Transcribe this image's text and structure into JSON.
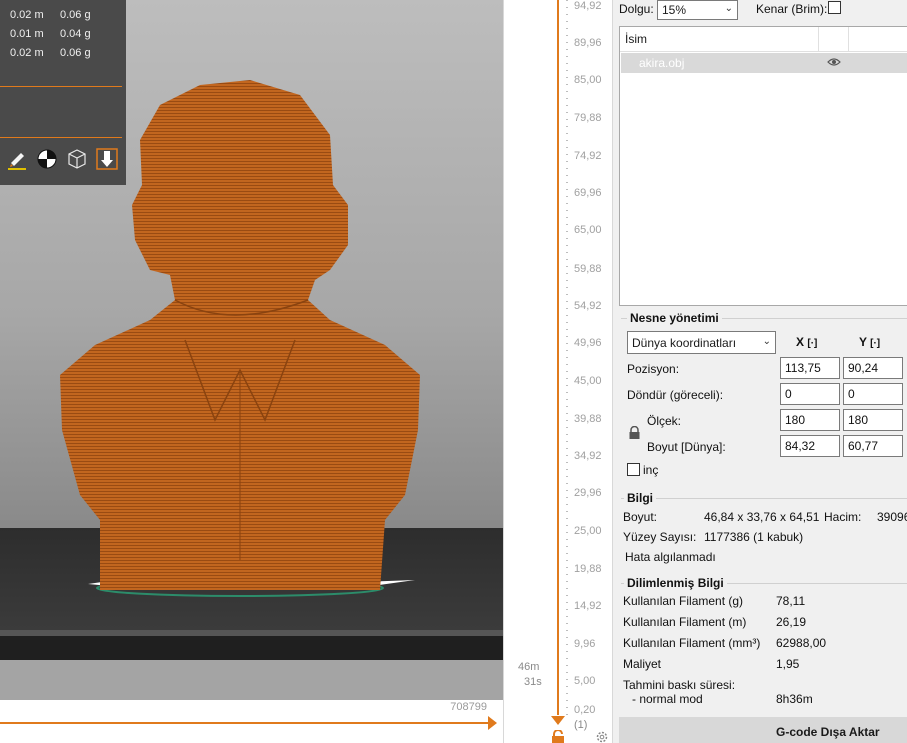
{
  "viewport": {
    "stats": [
      {
        "length": "0.02 m",
        "weight": "0.06 g"
      },
      {
        "length": "0.01 m",
        "weight": "0.04 g"
      },
      {
        "length": "0.02 m",
        "weight": "0.06 g"
      }
    ],
    "layer_count": "708799",
    "tools": [
      "paint-icon",
      "color-wheel-icon",
      "cube-icon",
      "download-arrow-icon"
    ]
  },
  "layer_slider": {
    "ticks": [
      "94,92",
      "89,96",
      "85,00",
      "79,88",
      "74,92",
      "69,96",
      "65,00",
      "59,88",
      "54,92",
      "49,96",
      "45,00",
      "39,88",
      "34,92",
      "29,96",
      "25,00",
      "19,88",
      "14,92",
      "9,96",
      "5,00",
      "0,20"
    ],
    "bottom_label": "(1)",
    "time_min": "46m",
    "time_sec": "31s"
  },
  "settings": {
    "infill_label": "Dolgu:",
    "infill_value": "15%",
    "brim_label": "Kenar (Brim):"
  },
  "object_list": {
    "header_name": "İsim",
    "items": [
      {
        "name": "akira.obj"
      }
    ]
  },
  "object_management": {
    "title": "Nesne yönetimi",
    "coord_mode": "Dünya koordinatları",
    "col_x": "X",
    "col_y": "Y",
    "position_label": "Pozisyon:",
    "position": {
      "x": "113,75",
      "y": "90,24"
    },
    "rotate_label": "Döndür (göreceli):",
    "rotate": {
      "x": "0",
      "y": "0"
    },
    "scale_label": "Ölçek:",
    "scale": {
      "x": "180",
      "y": "180"
    },
    "size_label": "Boyut [Dünya]:",
    "size": {
      "x": "84,32",
      "y": "60,77"
    },
    "inch_label": "inç"
  },
  "info": {
    "title": "Bilgi",
    "size_label": "Boyut:",
    "size_value": "46,84 x 33,76 x 64,51",
    "volume_label": "Hacim:",
    "volume_value": "39096",
    "facets_label": "Yüzey Sayısı:",
    "facets_value": "1177386 (1 kabuk)",
    "errors": "Hata algılanmadı"
  },
  "sliced": {
    "title": "Dilimlenmiş Bilgi",
    "rows": [
      {
        "label": "Kullanılan Filament (g)",
        "value": "78,11"
      },
      {
        "label": "Kullanılan Filament (m)",
        "value": "26,19"
      },
      {
        "label": "Kullanılan Filament (mm³)",
        "value": "62988,00"
      },
      {
        "label": "Maliyet",
        "value": "1,95"
      }
    ],
    "time_label": "Tahmini baskı süresi:",
    "mode_label": "- normal mod",
    "mode_value": "8h36m"
  },
  "export_label": "G-code Dışa Aktar",
  "colors": {
    "accent": "#e07a1c",
    "model": "#c2661f"
  }
}
